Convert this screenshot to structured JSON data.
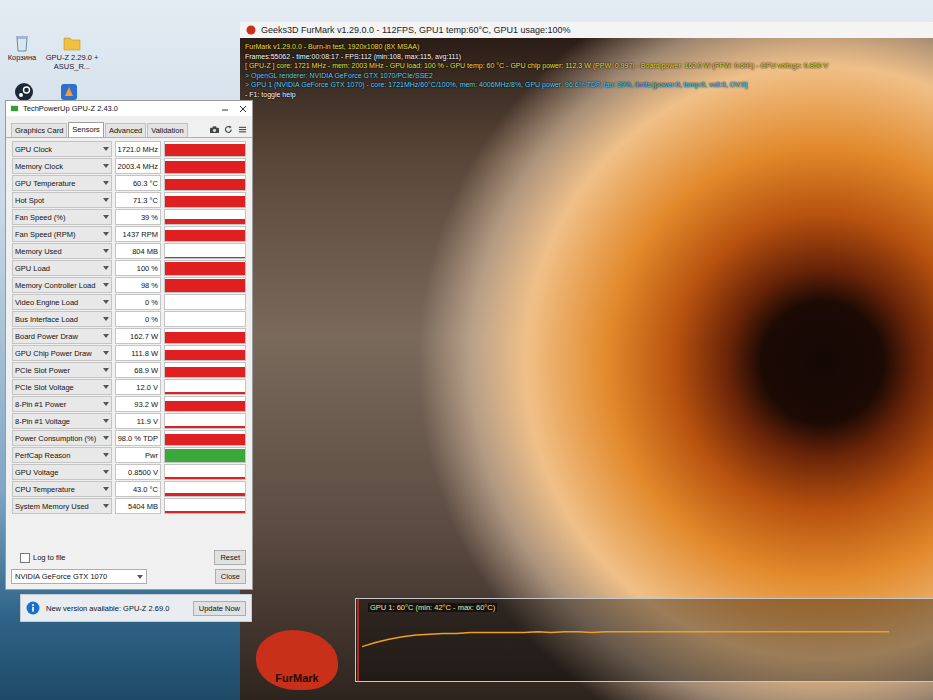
{
  "desktop": {
    "icons": [
      {
        "kind": "recycle-bin",
        "label": "Корзина"
      },
      {
        "kind": "folder",
        "label": "GPU-Z 2.29.0 + ASUS_R..."
      },
      {
        "kind": "steam"
      },
      {
        "kind": "app"
      }
    ]
  },
  "furmark": {
    "title": "Geeks3D FurMark v1.29.0.0 - 112FPS, GPU1 temp:60°C, GPU1 usage:100%",
    "overlay": [
      {
        "text": "FurMark v1.29.0.0 - Burn-in test, 1920x1080 (8X MSAA)",
        "color": "#f2e030"
      },
      {
        "text": "Frames:55062 - time:00:08:17 - FPS:112 (min:108, max:115, avg:111)",
        "color": "#ffffff"
      },
      {
        "text": "[ GPU-Z ] core: 1721 MHz - mem: 2003 MHz - GPU load: 100 % - GPU temp: 60 °C - GPU chip power: 112.3 W (PPW: 0.997) - Board power: 162.0 W (PPW: 0.691) - GPU voltage: 0.850 V",
        "color": "#f2e030"
      },
      {
        "text": "> OpenGL renderer: NVIDIA GeForce GTX 1070/PCIe/SSE2",
        "color": "#5fd8ff"
      },
      {
        "text": "> GPU 1 (NVIDIA GeForce GTX 1070) - core: 1721MHz/60°C/100%, mem: 4006MHz/8%, GPU power: 96.6% TDP, fan: 39%, limits:[power:0, temp:0, volt:0, OV:0]",
        "color": "#5fd8ff"
      },
      {
        "text": "- F1: toggle help",
        "color": "#ffffff"
      }
    ],
    "chart": {
      "label": "GPU 1: 60°C (min: 42°C - max: 60°C)",
      "series": [
        {
          "name": "GPU 1",
          "values": [
            42,
            47,
            51,
            54,
            56,
            57,
            58,
            58,
            59,
            59,
            59,
            59,
            59,
            60,
            59,
            60,
            60,
            59,
            60,
            60,
            60,
            60,
            60,
            60,
            60,
            60,
            60,
            60,
            60,
            60,
            60,
            60,
            60,
            60,
            60,
            60,
            60,
            60,
            60,
            60
          ]
        }
      ]
    },
    "logo": "FurMark"
  },
  "gpuz": {
    "title": "TechPowerUp GPU-Z 2.43.0",
    "tabs": [
      {
        "label": "Graphics Card",
        "selected": false
      },
      {
        "label": "Sensors",
        "selected": true
      },
      {
        "label": "Advanced",
        "selected": false
      },
      {
        "label": "Validation",
        "selected": false
      }
    ],
    "sensors": [
      {
        "name": "GPU Clock",
        "value": "1721.0 MHz",
        "level": 0.88,
        "color": "#e02020"
      },
      {
        "name": "Memory Clock",
        "value": "2003.4 MHz",
        "level": 0.88,
        "color": "#e02020"
      },
      {
        "name": "GPU Temperature",
        "value": "60.3 °C",
        "level": 0.8,
        "color": "#e02020"
      },
      {
        "name": "Hot Spot",
        "value": "71.3 °C",
        "level": 0.82,
        "color": "#e02020"
      },
      {
        "name": "Fan Speed (%)",
        "value": "39 %",
        "level": 0.35,
        "color": "#e02020"
      },
      {
        "name": "Fan Speed (RPM)",
        "value": "1437 RPM",
        "level": 0.8,
        "color": "#e02020"
      },
      {
        "name": "Memory Used",
        "value": "804 MB",
        "level": 0.1,
        "color": "#e02020"
      },
      {
        "name": "GPU Load",
        "value": "100 %",
        "level": 0.95,
        "color": "#e02020"
      },
      {
        "name": "Memory Controller Load",
        "value": "98 %",
        "level": 0.9,
        "color": "#e02020"
      },
      {
        "name": "Video Engine Load",
        "value": "0 %",
        "level": 0,
        "color": "#e02020"
      },
      {
        "name": "Bus Interface Load",
        "value": "0 %",
        "level": 0,
        "color": "#e02020"
      },
      {
        "name": "Board Power Draw",
        "value": "162.7 W",
        "level": 0.8,
        "color": "#e02020"
      },
      {
        "name": "GPU Chip Power Draw",
        "value": "111.8 W",
        "level": 0.7,
        "color": "#e02020"
      },
      {
        "name": "PCIe Slot Power",
        "value": "68.9 W",
        "level": 0.75,
        "color": "#e02020"
      },
      {
        "name": "PCIe Slot Voltage",
        "value": "12.0 V",
        "level": 0.12,
        "color": "#e02020"
      },
      {
        "name": "8-Pin #1 Power",
        "value": "93.2 W",
        "level": 0.75,
        "color": "#e02020"
      },
      {
        "name": "8-Pin #1 Voltage",
        "value": "11.9 V",
        "level": 0.12,
        "color": "#e02020"
      },
      {
        "name": "Power Consumption (%)",
        "value": "98.0 % TDP",
        "level": 0.8,
        "color": "#e02020"
      },
      {
        "name": "PerfCap Reason",
        "value": "Pwr",
        "level": 0.9,
        "color": "#3aa83a"
      },
      {
        "name": "GPU Voltage",
        "value": "0.8500 V",
        "level": 0.15,
        "color": "#e02020"
      },
      {
        "name": "CPU Temperature",
        "value": "43.0 °C",
        "level": 0.2,
        "color": "#e02020"
      },
      {
        "name": "System Memory Used",
        "value": "5404 MB",
        "level": 0.15,
        "color": "#e02020"
      }
    ],
    "log_to_file": {
      "label": "Log to file",
      "checked": false
    },
    "reset": "Reset",
    "device": "NVIDIA GeForce GTX 1070",
    "close": "Close"
  },
  "notification": {
    "text": "New version available: GPU-Z 2.69.0",
    "button": "Update Now"
  }
}
